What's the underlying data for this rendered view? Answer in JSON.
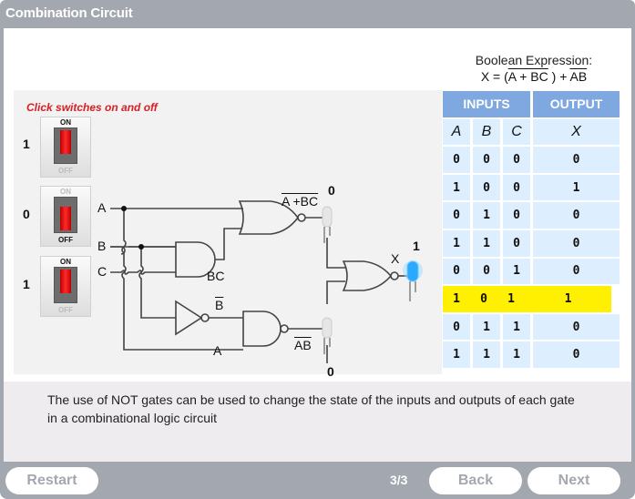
{
  "window": {
    "title": "Combination Circuit"
  },
  "expression": {
    "label": "Boolean Expression:",
    "prefix": "X = (",
    "nor_term": "A + BC",
    "mid": " ) + ",
    "nand_term": "AB"
  },
  "circuit": {
    "hint": "Click switches on and off",
    "switches": [
      {
        "name": "A",
        "value": "1",
        "state": "on",
        "on_label": "ON",
        "off_label": "OFF"
      },
      {
        "name": "B",
        "value": "0",
        "state": "off",
        "on_label": "ON",
        "off_label": "OFF"
      },
      {
        "name": "C",
        "value": "1",
        "state": "on",
        "on_label": "ON",
        "off_label": "OFF"
      }
    ],
    "labels": {
      "a": "A",
      "b": "B",
      "c": "C",
      "bc": "BC",
      "not_b": "B",
      "a_bottom": "A",
      "nor_out": "A +BC",
      "nand_out": "AB",
      "x": "X"
    },
    "leds": {
      "nor_value": "0",
      "nand_value": "0",
      "x_value": "1"
    },
    "colors": {
      "led_on": "#2aa9ff",
      "switch_red": "#e8161c"
    }
  },
  "truth_table": {
    "header_inputs": "INPUTS",
    "header_output": "OUTPUT",
    "columns": [
      "A",
      "B",
      "C",
      "X"
    ],
    "rows": [
      [
        "0",
        "0",
        "0",
        "0"
      ],
      [
        "1",
        "0",
        "0",
        "1"
      ],
      [
        "0",
        "1",
        "0",
        "0"
      ],
      [
        "1",
        "1",
        "0",
        "0"
      ],
      [
        "0",
        "0",
        "1",
        "0"
      ],
      [
        "1",
        "0",
        "1",
        "1"
      ],
      [
        "0",
        "1",
        "1",
        "0"
      ],
      [
        "1",
        "1",
        "1",
        "0"
      ]
    ],
    "highlighted_row": 5,
    "highlight_color": "#ffef00"
  },
  "description": "The use of NOT gates can be used to change the state of the inputs and outputs of each gate in a combinational logic circuit",
  "footer": {
    "restart_label": "Restart",
    "page_indicator": "3/3",
    "back_label": "Back",
    "next_label": "Next"
  }
}
